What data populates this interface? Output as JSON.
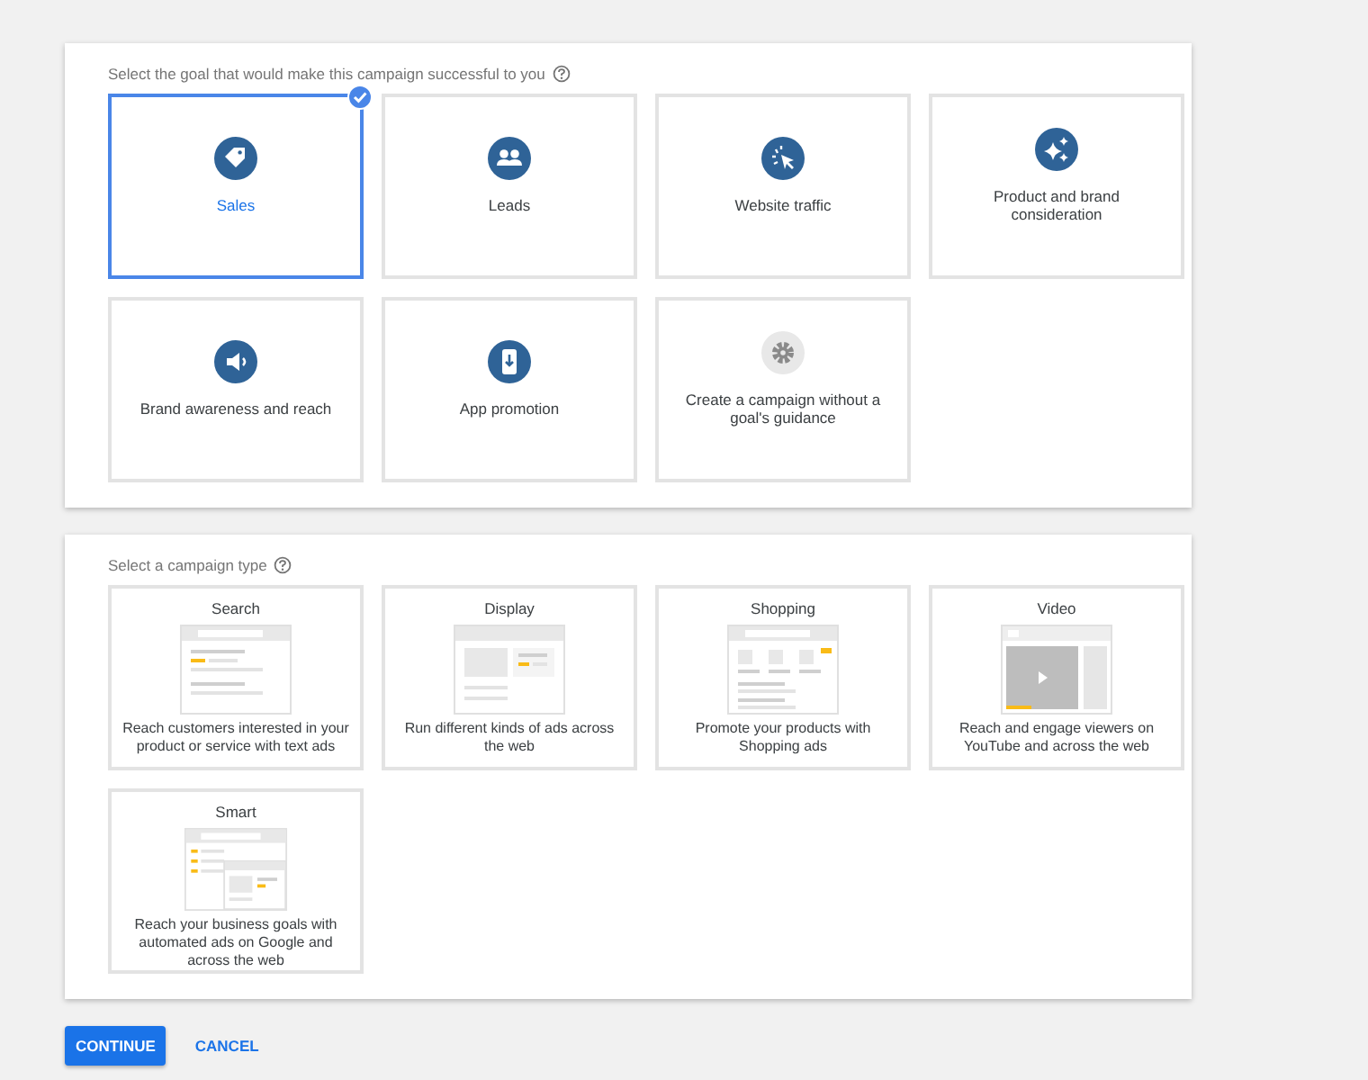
{
  "goal_section": {
    "prompt": "Select the goal that would make this campaign successful to you",
    "goals": [
      {
        "label": "Sales",
        "kind": "tag",
        "selected": true
      },
      {
        "label": "Leads",
        "kind": "people",
        "selected": false
      },
      {
        "label": "Website traffic",
        "kind": "cursor",
        "selected": false
      },
      {
        "label": "Product and brand consideration",
        "kind": "sparkle",
        "selected": false
      },
      {
        "label": "Brand awareness and reach",
        "kind": "megaphone",
        "selected": false
      },
      {
        "label": "App promotion",
        "kind": "phone",
        "selected": false
      },
      {
        "label": "Create a campaign without a goal's guidance",
        "kind": "gear",
        "selected": false
      }
    ]
  },
  "type_section": {
    "prompt": "Select a campaign type",
    "types": [
      {
        "title": "Search",
        "description": "Reach customers interested in your product or service with text ads",
        "kind": "search",
        "selected": false
      },
      {
        "title": "Display",
        "description": "Run different kinds of ads across the web",
        "kind": "display",
        "selected": false
      },
      {
        "title": "Shopping",
        "description": "Promote your products with Shopping ads",
        "kind": "shopping",
        "selected": false
      },
      {
        "title": "Video",
        "description": "Reach and engage viewers on YouTube and across the web",
        "kind": "video",
        "selected": false
      },
      {
        "title": "Smart",
        "description": "Reach your business goals with automated ads on Google and across the web",
        "kind": "smart",
        "selected": false
      }
    ]
  },
  "buttons": [
    {
      "label": "CONTINUE",
      "kind": "primary"
    },
    {
      "label": "CANCEL",
      "kind": "text"
    }
  ]
}
